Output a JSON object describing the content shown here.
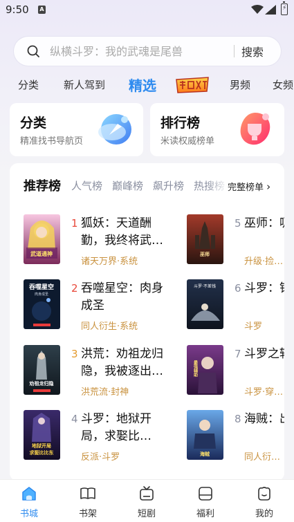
{
  "status": {
    "time": "9:50",
    "notif": "A"
  },
  "search": {
    "placeholder": "纵横斗罗：我的武魂是尾兽",
    "button": "搜索"
  },
  "tabs": [
    "分类",
    "新人驾到",
    "精选",
    "男频",
    "女频"
  ],
  "tab_promo_label": "超级新书",
  "cards": [
    {
      "title": "分类",
      "sub": "精准找书导航页"
    },
    {
      "title": "排行榜",
      "sub": "米读权威榜单"
    }
  ],
  "ranking": {
    "title": "推荐榜",
    "tabs": [
      "人气榜",
      "巅峰榜",
      "飙升榜",
      "热搜榜"
    ],
    "more": "完整榜单",
    "books": [
      {
        "num": "1",
        "title": "狐妖：天道酬勤，我终将武…",
        "tag": "诸天万界·系统",
        "cover_text": "斗破苍穹：武道通神"
      },
      {
        "num": "2",
        "title": "吞噬星空：肉身成圣",
        "tag": "同人衍生·系统",
        "cover_text": "吞噬星空 肉身成圣"
      },
      {
        "num": "3",
        "title": "洪荒：劝祖龙归隐，我被逐出…",
        "tag": "洪荒流·封神",
        "cover_text": "劝祖龙归隐"
      },
      {
        "num": "4",
        "title": "斗罗：地狱开局，求娶比…",
        "tag": "反派·斗罗",
        "cover_text": "斗罗 地狱开局 求娶比比东"
      },
      {
        "num": "5",
        "title": "巫师：吸法开…",
        "tag": "升级·捡…",
        "cover_text": "巫师 吸法"
      },
      {
        "num": "6",
        "title": "斗罗：钱！",
        "tag": "斗罗",
        "cover_text": "斗罗 不差钱"
      },
      {
        "num": "7",
        "title": "斗罗之辅助",
        "tag": "斗罗·穿…",
        "cover_text": "斗罗 最强辅助"
      },
      {
        "num": "8",
        "title": "海贼：出剑",
        "tag": "同人衍…",
        "cover_text": "海贼 我的剑"
      }
    ]
  },
  "nav": [
    {
      "label": "书城",
      "icon": "bookstore-icon"
    },
    {
      "label": "书架",
      "icon": "bookshelf-icon"
    },
    {
      "label": "短剧",
      "icon": "short-drama-icon"
    },
    {
      "label": "福利",
      "icon": "welfare-icon"
    },
    {
      "label": "我的",
      "icon": "profile-icon"
    }
  ],
  "colors": {
    "accent": "#2e8bef",
    "rank_top": "#e8483a",
    "rank_mid": "#e49a2e",
    "rank_low": "#8a8fa0",
    "tag": "#c9923f"
  }
}
